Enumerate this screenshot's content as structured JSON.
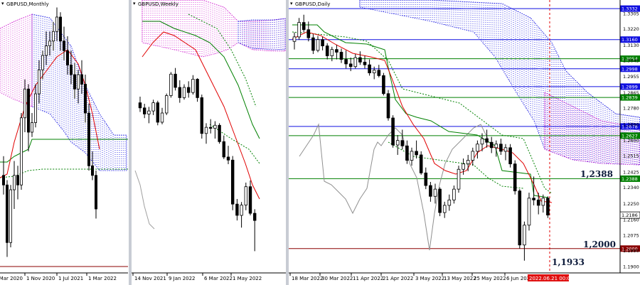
{
  "chart_data": [
    {
      "type": "candlestick",
      "title": "GBPUSD,Monthly",
      "x_tick_labels": [
        "1 Mar 2020",
        "1 Nov 2020",
        "1 Jul 2021",
        "1 Mar 2022"
      ],
      "ohlc_approx": [
        [
          1.245,
          1.265,
          1.225,
          1.235
        ],
        [
          1.235,
          1.24,
          1.16,
          1.175
        ],
        [
          1.175,
          1.235,
          1.17,
          1.23
        ],
        [
          1.23,
          1.26,
          1.21,
          1.245
        ],
        [
          1.245,
          1.255,
          1.22,
          1.235
        ],
        [
          1.235,
          1.31,
          1.23,
          1.305
        ],
        [
          1.305,
          1.345,
          1.29,
          1.335
        ],
        [
          1.335,
          1.34,
          1.27,
          1.29
        ],
        [
          1.29,
          1.31,
          1.285,
          1.3
        ],
        [
          1.3,
          1.34,
          1.295,
          1.33
        ],
        [
          1.33,
          1.365,
          1.32,
          1.355
        ],
        [
          1.355,
          1.375,
          1.345,
          1.37
        ],
        [
          1.37,
          1.395,
          1.36,
          1.38
        ],
        [
          1.38,
          1.395,
          1.37,
          1.385
        ],
        [
          1.385,
          1.405,
          1.375,
          1.395
        ],
        [
          1.395,
          1.42,
          1.385,
          1.41
        ],
        [
          1.41,
          1.415,
          1.375,
          1.385
        ],
        [
          1.385,
          1.4,
          1.365,
          1.375
        ],
        [
          1.375,
          1.39,
          1.35,
          1.36
        ],
        [
          1.36,
          1.375,
          1.34,
          1.35
        ],
        [
          1.35,
          1.362,
          1.325,
          1.335
        ],
        [
          1.335,
          1.355,
          1.32,
          1.35
        ],
        [
          1.35,
          1.365,
          1.33,
          1.34
        ],
        [
          1.34,
          1.35,
          1.3,
          1.31
        ],
        [
          1.31,
          1.32,
          1.25,
          1.255
        ],
        [
          1.255,
          1.27,
          1.24,
          1.245
        ],
        [
          1.245,
          1.25,
          1.2,
          1.21
        ]
      ]
    },
    {
      "type": "candlestick",
      "title": "GBPUSD,Weekly",
      "x_tick_labels": [
        "14 Nov 2021",
        "9 Jan 2022",
        "6 Mar 2022",
        "1 May 2022"
      ],
      "ohlc_approx": [
        [
          1.34,
          1.346,
          1.331,
          1.335
        ],
        [
          1.335,
          1.339,
          1.325,
          1.329
        ],
        [
          1.329,
          1.336,
          1.32,
          1.332
        ],
        [
          1.332,
          1.343,
          1.328,
          1.34
        ],
        [
          1.34,
          1.342,
          1.318,
          1.321
        ],
        [
          1.321,
          1.335,
          1.319,
          1.33
        ],
        [
          1.33,
          1.349,
          1.328,
          1.347
        ],
        [
          1.347,
          1.37,
          1.345,
          1.368
        ],
        [
          1.368,
          1.374,
          1.352,
          1.355
        ],
        [
          1.355,
          1.362,
          1.34,
          1.345
        ],
        [
          1.345,
          1.358,
          1.343,
          1.355
        ],
        [
          1.355,
          1.361,
          1.345,
          1.35
        ],
        [
          1.35,
          1.367,
          1.348,
          1.363
        ],
        [
          1.363,
          1.364,
          1.341,
          1.345
        ],
        [
          1.345,
          1.348,
          1.305,
          1.31
        ],
        [
          1.31,
          1.32,
          1.3,
          1.316
        ],
        [
          1.316,
          1.324,
          1.31,
          1.315
        ],
        [
          1.315,
          1.322,
          1.305,
          1.318
        ],
        [
          1.318,
          1.32,
          1.3,
          1.302
        ],
        [
          1.302,
          1.308,
          1.285,
          1.287
        ],
        [
          1.287,
          1.298,
          1.28,
          1.284
        ],
        [
          1.284,
          1.288,
          1.235,
          1.241
        ],
        [
          1.241,
          1.246,
          1.225,
          1.23
        ],
        [
          1.23,
          1.243,
          1.218,
          1.24
        ],
        [
          1.24,
          1.262,
          1.235,
          1.258
        ],
        [
          1.258,
          1.264,
          1.23,
          1.232
        ],
        [
          1.232,
          1.236,
          1.195,
          1.225
        ]
      ]
    },
    {
      "type": "candlestick",
      "title": "GBPUSD,Daily",
      "x_tick_labels": [
        "18 Mar 2022",
        "30 Mar 2022",
        "11 Apr 2022",
        "21 Apr 2022",
        "3 May 2022",
        "13 May 2022",
        "25 May 2022",
        "6 Jun 2022",
        "2022.06.21 00:00"
      ],
      "y_tick_labels": [
        "1.3305",
        "1.3220",
        "1.3130",
        "1.3045",
        "1.2955",
        "1.2865",
        "1.2780",
        "1.2690",
        "1.2600",
        "1.2515",
        "1.2425",
        "1.2340",
        "1.2250",
        "1.2160",
        "1.2075",
        "1.1990",
        "1.1900"
      ],
      "ylim": [
        1.1865,
        1.336
      ],
      "current_price": "1.2186",
      "levels": [
        {
          "label": "1.3332",
          "value": 1.3332,
          "color": "#1010e0"
        },
        {
          "label": "1.3160",
          "value": 1.316,
          "color": "#1010e0"
        },
        {
          "label": "1.3054",
          "value": 1.3054,
          "color": "#008000"
        },
        {
          "label": "1.2998",
          "value": 1.2998,
          "color": "#1010e0"
        },
        {
          "label": "1.2899",
          "value": 1.2899,
          "color": "#1010e0"
        },
        {
          "label": "1.2839",
          "value": 1.2839,
          "color": "#008000"
        },
        {
          "label": "1.2678",
          "value": 1.2678,
          "color": "#1010e0"
        },
        {
          "label": "1.2627",
          "value": 1.2627,
          "color": "#008000"
        },
        {
          "label": "1.2388",
          "value": 1.2388,
          "color": "#008000"
        },
        {
          "label": "1.2000",
          "value": 1.2,
          "color": "#8b0000"
        }
      ],
      "annotations": [
        "1,2388",
        "1,2000",
        "1,1933"
      ],
      "ohlc_approx": [
        [
          1.315,
          1.32,
          1.3105,
          1.3175
        ],
        [
          1.3175,
          1.328,
          1.316,
          1.3255
        ],
        [
          1.3255,
          1.3298,
          1.32,
          1.3215
        ],
        [
          1.3215,
          1.326,
          1.315,
          1.317
        ],
        [
          1.317,
          1.319,
          1.308,
          1.31
        ],
        [
          1.31,
          1.318,
          1.309,
          1.316
        ],
        [
          1.316,
          1.3175,
          1.31,
          1.3125
        ],
        [
          1.3125,
          1.314,
          1.305,
          1.307
        ],
        [
          1.307,
          1.312,
          1.304,
          1.3105
        ],
        [
          1.3105,
          1.313,
          1.305,
          1.309
        ],
        [
          1.309,
          1.311,
          1.303,
          1.305
        ],
        [
          1.305,
          1.31,
          1.3,
          1.3025
        ],
        [
          1.3025,
          1.306,
          1.2985,
          1.301
        ],
        [
          1.301,
          1.308,
          1.3,
          1.306
        ],
        [
          1.306,
          1.3095,
          1.302,
          1.3035
        ],
        [
          1.3035,
          1.307,
          1.3,
          1.302
        ],
        [
          1.302,
          1.305,
          1.296,
          1.2975
        ],
        [
          1.2975,
          1.301,
          1.294,
          1.299
        ],
        [
          1.299,
          1.302,
          1.295,
          1.296
        ],
        [
          1.296,
          1.2975,
          1.285,
          1.286
        ],
        [
          1.286,
          1.288,
          1.271,
          1.2725
        ],
        [
          1.2725,
          1.274,
          1.256,
          1.2575
        ],
        [
          1.2575,
          1.263,
          1.252,
          1.26
        ],
        [
          1.26,
          1.266,
          1.255,
          1.257
        ],
        [
          1.257,
          1.26,
          1.247,
          1.249
        ],
        [
          1.249,
          1.256,
          1.246,
          1.254
        ],
        [
          1.254,
          1.26,
          1.25,
          1.252
        ],
        [
          1.252,
          1.254,
          1.241,
          1.242
        ],
        [
          1.242,
          1.245,
          1.233,
          1.235
        ],
        [
          1.235,
          1.237,
          1.226,
          1.229
        ],
        [
          1.229,
          1.236,
          1.225,
          1.233
        ],
        [
          1.233,
          1.234,
          1.218,
          1.22
        ],
        [
          1.22,
          1.226,
          1.217,
          1.224
        ],
        [
          1.224,
          1.23,
          1.221,
          1.227
        ],
        [
          1.227,
          1.235,
          1.225,
          1.233
        ],
        [
          1.233,
          1.246,
          1.231,
          1.244
        ],
        [
          1.244,
          1.25,
          1.241,
          1.247
        ],
        [
          1.247,
          1.252,
          1.243,
          1.249
        ],
        [
          1.249,
          1.256,
          1.246,
          1.254
        ],
        [
          1.254,
          1.26,
          1.25,
          1.258
        ],
        [
          1.258,
          1.264,
          1.254,
          1.261
        ],
        [
          1.261,
          1.266,
          1.256,
          1.259
        ],
        [
          1.259,
          1.262,
          1.253,
          1.256
        ],
        [
          1.256,
          1.26,
          1.251,
          1.258
        ],
        [
          1.258,
          1.261,
          1.252,
          1.254
        ],
        [
          1.254,
          1.258,
          1.249,
          1.256
        ],
        [
          1.256,
          1.258,
          1.245,
          1.247
        ],
        [
          1.247,
          1.249,
          1.23,
          1.232
        ],
        [
          1.232,
          1.233,
          1.2,
          1.202
        ],
        [
          1.202,
          1.215,
          1.1933,
          1.213
        ],
        [
          1.213,
          1.231,
          1.21,
          1.228
        ],
        [
          1.228,
          1.24,
          1.224,
          1.227
        ],
        [
          1.227,
          1.231,
          1.219,
          1.224
        ],
        [
          1.224,
          1.23,
          1.22,
          1.228
        ],
        [
          1.228,
          1.229,
          1.217,
          1.2186
        ]
      ]
    }
  ]
}
